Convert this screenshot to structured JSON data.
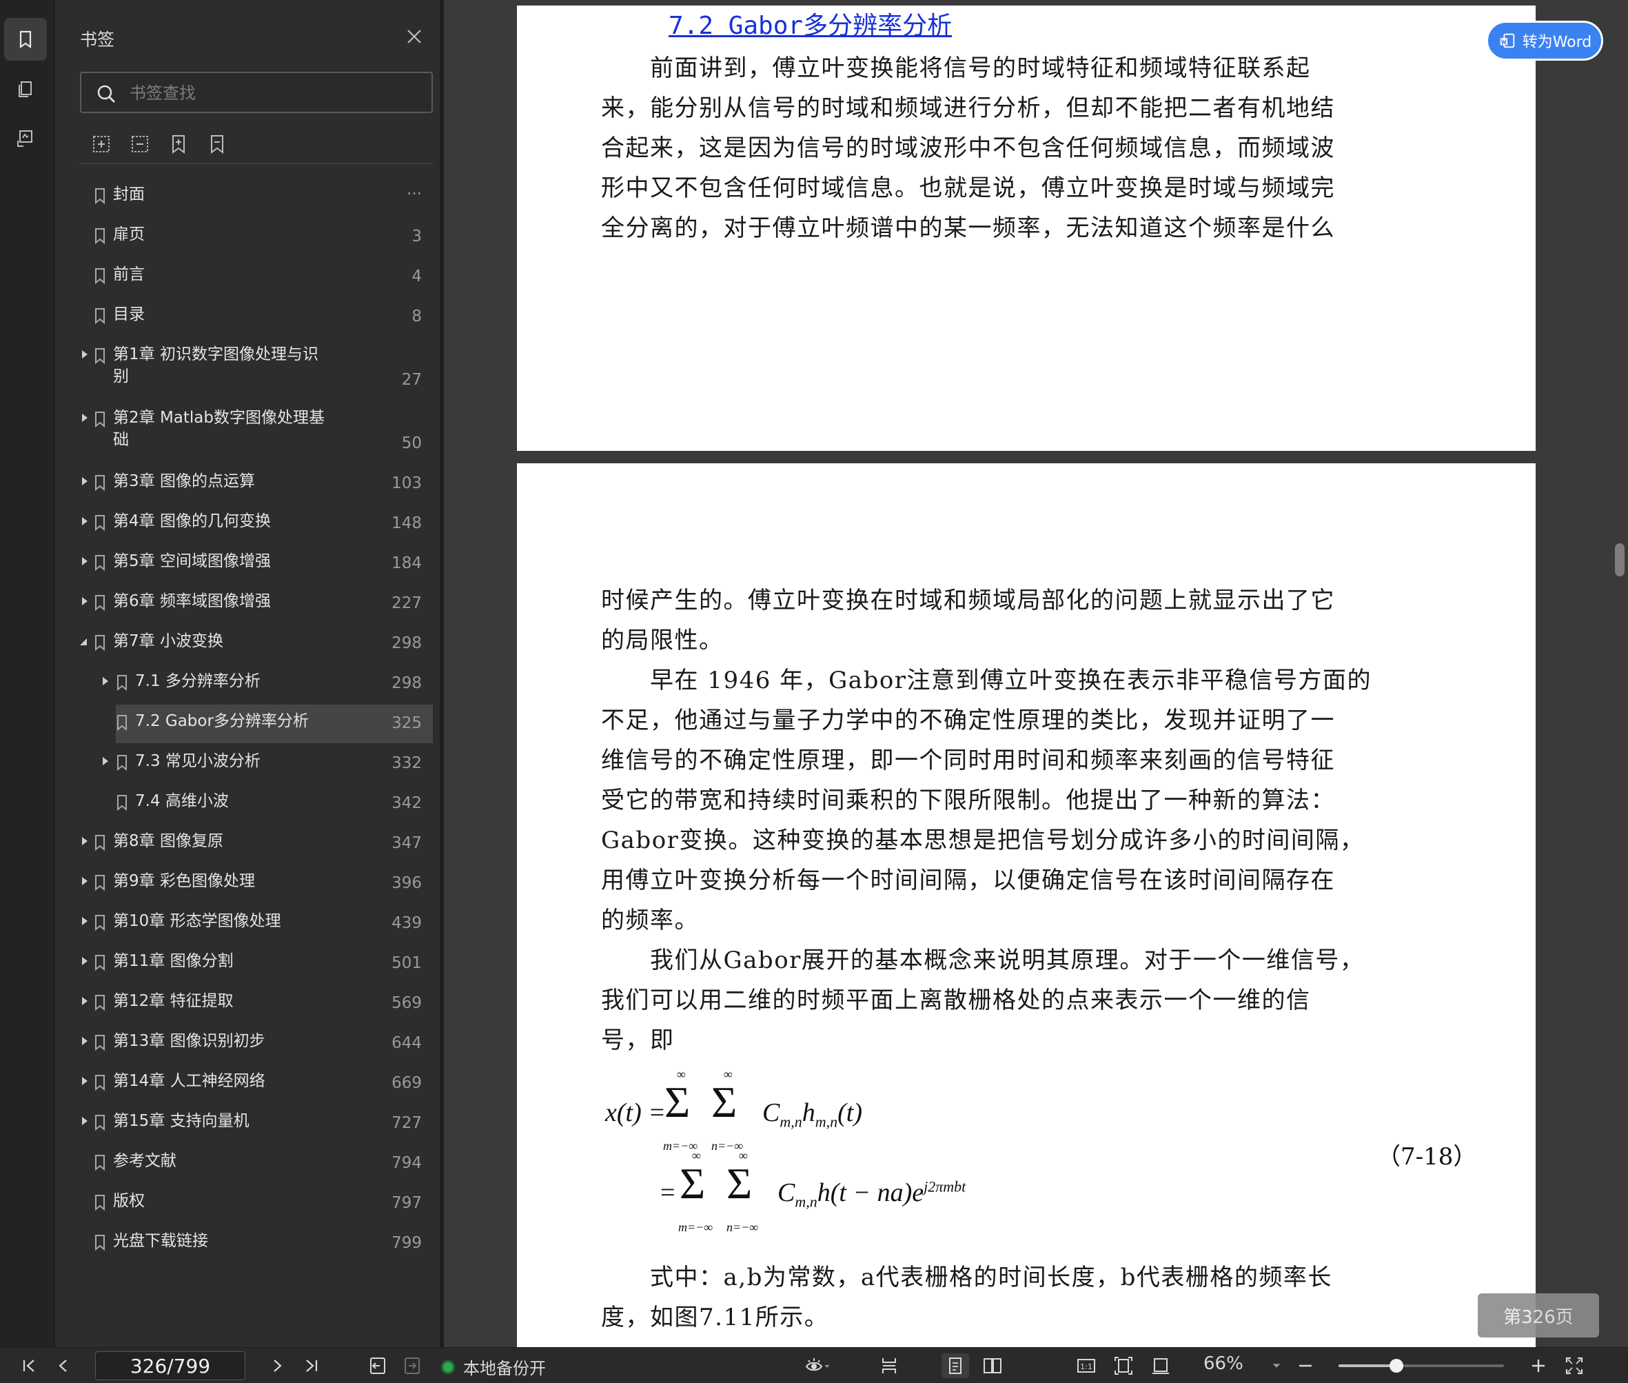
{
  "sidebar": {
    "title": "书签",
    "search_placeholder": "书签查找",
    "bookmarks": [
      {
        "label": "封面",
        "page": "...",
        "arrow": "none"
      },
      {
        "label": "扉页",
        "page": "3",
        "arrow": "none"
      },
      {
        "label": "前言",
        "page": "4",
        "arrow": "none"
      },
      {
        "label": "目录",
        "page": "8",
        "arrow": "none"
      },
      {
        "label": "第1章 初识数字图像处理与识\n别",
        "page": "27",
        "arrow": "right"
      },
      {
        "label": "第2章 Matlab数字图像处理基\n础",
        "page": "50",
        "arrow": "right"
      },
      {
        "label": "第3章 图像的点运算",
        "page": "103",
        "arrow": "right"
      },
      {
        "label": "第4章 图像的几何变换",
        "page": "148",
        "arrow": "right"
      },
      {
        "label": "第5章 空间域图像增强",
        "page": "184",
        "arrow": "right"
      },
      {
        "label": "第6章 频率域图像增强",
        "page": "227",
        "arrow": "right"
      },
      {
        "label": "第7章 小波变换",
        "page": "298",
        "arrow": "down"
      },
      {
        "label": "7.1 多分辨率分析",
        "page": "298",
        "arrow": "right",
        "level": 1
      },
      {
        "label": "7.2 Gabor多分辨率分析",
        "page": "325",
        "arrow": "none",
        "level": 1,
        "selected": true
      },
      {
        "label": "7.3 常见小波分析",
        "page": "332",
        "arrow": "right",
        "level": 1
      },
      {
        "label": "7.4 高维小波",
        "page": "342",
        "arrow": "none",
        "level": 1
      },
      {
        "label": "第8章 图像复原",
        "page": "347",
        "arrow": "right"
      },
      {
        "label": "第9章 彩色图像处理",
        "page": "396",
        "arrow": "right"
      },
      {
        "label": "第10章 形态学图像处理",
        "page": "439",
        "arrow": "right"
      },
      {
        "label": "第11章 图像分割",
        "page": "501",
        "arrow": "right"
      },
      {
        "label": "第12章 特征提取",
        "page": "569",
        "arrow": "right"
      },
      {
        "label": "第13章 图像识别初步",
        "page": "644",
        "arrow": "right"
      },
      {
        "label": "第14章 人工神经网络",
        "page": "669",
        "arrow": "right"
      },
      {
        "label": "第15章 支持向量机",
        "page": "727",
        "arrow": "right"
      },
      {
        "label": "参考文献",
        "page": "794",
        "arrow": "none"
      },
      {
        "label": "版权",
        "page": "797",
        "arrow": "none"
      },
      {
        "label": "光盘下载链接",
        "page": "799",
        "arrow": "none"
      }
    ]
  },
  "document": {
    "section_heading": "7.2 Gabor多分辨率分析",
    "page1_lines": [
      "　　前面讲到，傅立叶变换能将信号的时域特征和频域特征联系起",
      "来，能分别从信号的时域和频域进行分析，但却不能把二者有机地结",
      "合起来，这是因为信号的时域波形中不包含任何频域信息，而频域波",
      "形中又不包含任何时域信息。也就是说，傅立叶变换是时域与频域完",
      "全分离的，对于傅立叶频谱中的某一频率，无法知道这个频率是什么"
    ],
    "page2_lines": [
      "时候产生的。傅立叶变换在时域和频域局部化的问题上就显示出了它",
      "的局限性。",
      "　　早在 1946 年，Gabor注意到傅立叶变换在表示非平稳信号方面的",
      "不足，他通过与量子力学中的不确定性原理的类比，发现并证明了一",
      "维信号的不确定性原理，即一个同时用时间和频率来刻画的信号特征",
      "受它的带宽和持续时间乘积的下限所限制。他提出了一种新的算法：",
      "Gabor变换。这种变换的基本思想是把信号划分成许多小的时间间隔，",
      "用傅立叶变换分析每一个时间间隔，以便确定信号在该时间间隔存在",
      "的频率。",
      "　　我们从Gabor展开的基本概念来说明其原理。对于一个一维信号，",
      "我们可以用二维的时频平面上离散栅格处的点来表示一个一维的信",
      "号，即"
    ],
    "page2_after_lines": [
      "　　式中：a,b为常数，a代表栅格的时间长度，b代表栅格的频率长",
      "度，如图7.11所示。"
    ],
    "equation": {
      "lhs": "x(t) =",
      "sigma1_sup": "∞",
      "sigma1_sub": "m=−∞",
      "sigma2_sup": "∞",
      "sigma2_sub": "n=−∞",
      "term1": "C",
      "term1_sub": "m,n",
      "term1_h": "h",
      "term1_hsub": "m,n",
      "term1_tail": "(t)",
      "eq2": "=",
      "term2": "C",
      "term2_sub": "m,n",
      "term2_h": "h(t − na)e",
      "term2_sup": "j2πmbt",
      "number": "（7-18）"
    },
    "convert_button": "转为Word",
    "page_badge": "第326页"
  },
  "statusbar": {
    "page_value": "326/799",
    "backup_label": "本地备份开",
    "zoom": "66%",
    "zoom_fraction": 0.35
  }
}
